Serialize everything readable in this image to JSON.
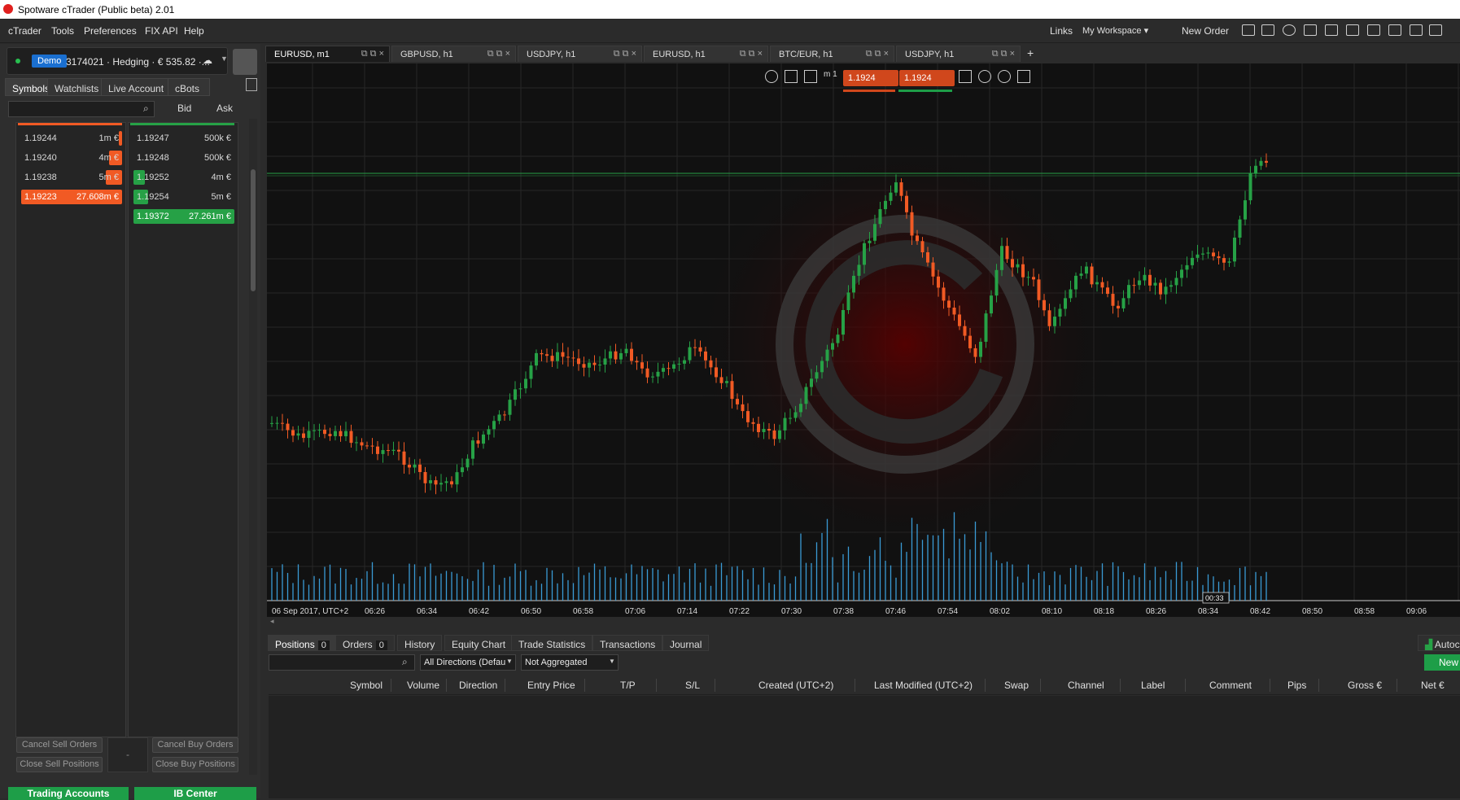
{
  "app": {
    "title": "Spotware cTrader (Public beta) 2.01"
  },
  "menu": [
    "cTrader",
    "Tools",
    "Preferences",
    "FIX API",
    "Help"
  ],
  "topbar": {
    "links": "Links",
    "workspace": "My Workspace ▾",
    "new_order": "New Order"
  },
  "account": {
    "mode": "Demo",
    "info": "3174021 · Hedging · € 535.82 ·...",
    "cloud": "☁"
  },
  "left_tabs": [
    "Symbols",
    "Watchlists",
    "Live Account",
    "cBots"
  ],
  "dom": {
    "bid_label": "Bid",
    "ask_label": "Ask",
    "bids": [
      {
        "price": "1.19244",
        "vol": "1m €"
      },
      {
        "price": "1.19240",
        "vol": "4m €"
      },
      {
        "price": "1.19238",
        "vol": "5m €"
      },
      {
        "price": "1.19223",
        "vol": "27.608m €"
      }
    ],
    "asks": [
      {
        "price": "1.19247",
        "vol": "500k €"
      },
      {
        "price": "1.19248",
        "vol": "500k €"
      },
      {
        "price": "1.19252",
        "vol": "4m €"
      },
      {
        "price": "1.19254",
        "vol": "5m €"
      },
      {
        "price": "1.19372",
        "vol": "27.261m €"
      }
    ],
    "cancel_sell": "Cancel Sell Orders",
    "close_sell": "Close Sell Positions",
    "cancel_buy": "Cancel Buy Orders",
    "close_buy": "Close Buy Positions",
    "dash": "-",
    "trading_accounts": "Trading Accounts",
    "ib_center": "IB Center"
  },
  "chart_tabs": [
    "EURUSD, m1",
    "GBPUSD, h1",
    "USDJPY, h1",
    "EURUSD, h1",
    "BTC/EUR, h1",
    "USDJPY, h1"
  ],
  "chart": {
    "sell_price": "1.1924",
    "buy_price": "1.1924",
    "timeframe": "m 1",
    "date_label": "06 Sep 2017, UTC+2",
    "time_ticks": [
      "06:26",
      "06:34",
      "06:42",
      "06:50",
      "06:58",
      "07:06",
      "07:14",
      "07:22",
      "07:30",
      "07:38",
      "07:46",
      "07:54",
      "08:02",
      "08:10",
      "08:18",
      "08:26",
      "08:34",
      "08:42",
      "08:50",
      "08:58",
      "09:06"
    ],
    "countdown": "00:33",
    "bull_color": "#26a146",
    "bear_color": "#f15a24",
    "volume_color": "#3a9bd5"
  },
  "bottom_tabs": [
    {
      "label": "Positions",
      "count": "0"
    },
    {
      "label": "Orders",
      "count": "0"
    },
    {
      "label": "History"
    },
    {
      "label": "Equity Chart"
    },
    {
      "label": "Trade Statistics"
    },
    {
      "label": "Transactions"
    },
    {
      "label": "Journal"
    }
  ],
  "bottom_right": {
    "auto": "Autoc",
    "new_order": "New O"
  },
  "filters": {
    "direction": "All Directions (Defau",
    "aggregation": "Not Aggregated"
  },
  "columns": [
    "Symbol",
    "Volume",
    "Direction",
    "Entry Price",
    "T/P",
    "S/L",
    "Created (UTC+2)",
    "Last Modified (UTC+2)",
    "Swap",
    "Channel",
    "Label",
    "Comment",
    "Pips",
    "Gross €",
    "Net €"
  ]
}
